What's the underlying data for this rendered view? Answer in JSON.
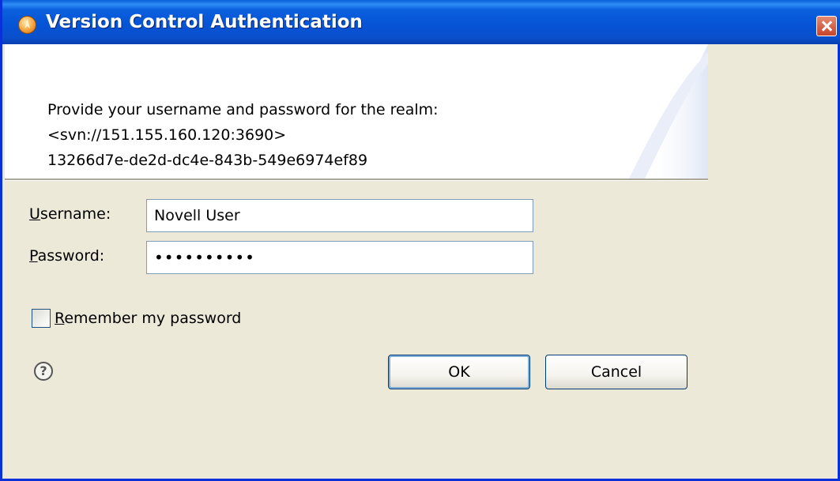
{
  "window": {
    "title": "Version Control Authentication",
    "icon": "app-icon",
    "close_icon": "close-icon"
  },
  "banner": {
    "message_line1": "Provide your username and password for the realm:",
    "message_line2": "<svn://151.155.160.120:3690>",
    "message_line3": "13266d7e-de2d-dc4e-843b-549e6974ef89"
  },
  "form": {
    "username_label_mnemonic": "U",
    "username_label_rest": "sername:",
    "username_value": "Novell User",
    "password_label_mnemonic": "P",
    "password_label_rest": "assword:",
    "password_value": "••••••••••",
    "remember_mnemonic": "R",
    "remember_rest": "emember my password",
    "remember_checked": false
  },
  "buttons": {
    "help_icon": "help-icon",
    "help_glyph": "?",
    "ok_label": "OK",
    "cancel_label": "Cancel"
  },
  "colors": {
    "titlebar": "#0554d6",
    "dialog_bg": "#ece9d8",
    "banner_bg": "#ffffff",
    "field_border": "#7f9db9"
  }
}
